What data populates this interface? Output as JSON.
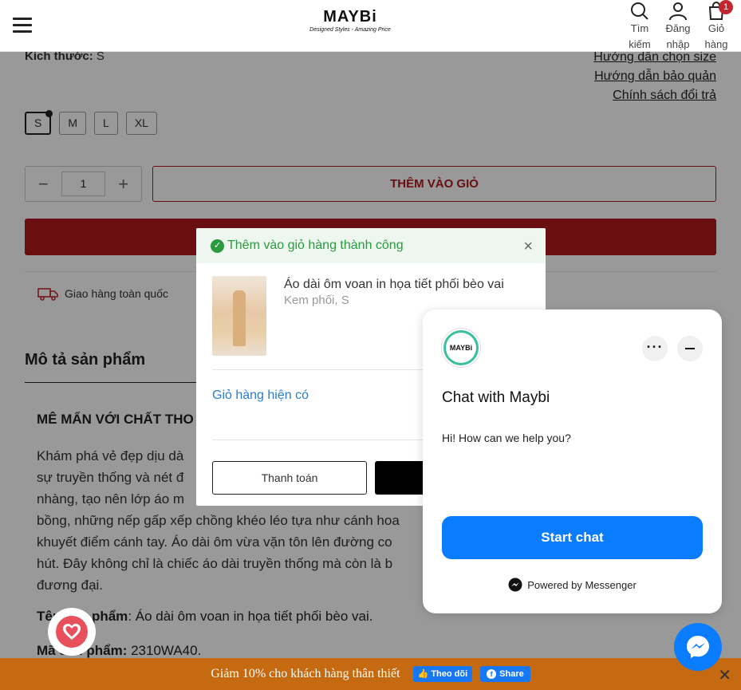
{
  "header": {
    "logo_text": "MAYBi",
    "logo_tagline": "Designed Styles - Amazing Price",
    "search_label_1": "Tìm",
    "search_label_2": "kiếm",
    "login_label_1": "Đăng",
    "login_label_2": "nhập",
    "cart_label_1": "Giỏ",
    "cart_label_2": "hàng",
    "cart_count": "1"
  },
  "product": {
    "size_label": "Kích thước:",
    "size_value": "S",
    "guide_links": [
      "Hướng dẫn chọn size",
      "Hướng dẫn bảo quản",
      "Chính sách đổi trả"
    ],
    "size_options": [
      "S",
      "M",
      "L",
      "XL"
    ],
    "selected_size": "S",
    "quantity": "1",
    "qty_minus": "−",
    "qty_plus": "+",
    "add_to_cart_label": "THÊM VÀO GIỎ",
    "delivery_text": "Giao hàng toàn quốc"
  },
  "description": {
    "section_title": "Mô tả sản phẩm",
    "heading": "MÊ MẨN VỚI CHẤT THO",
    "body_lines": [
      "Khám phá vẻ đẹp dịu dà",
      "sự truyền thống và nét đ",
      "nhàng, tạo nên lớp áo m",
      "bồng, những nếp gấp xếp chồng khéo léo tựa như cánh hoa",
      "khuyết điểm cánh tay. Áo dài ôm vừa vặn tôn lên đường co",
      "hút. Đây không chỉ là chiếc áo dài truyền thống mà còn là b",
      "đương đại."
    ],
    "spec1_label": "Tên sản phẩm",
    "spec1_value": ": Áo dài ôm voan in họa tiết phối bèo vai.",
    "spec2_label": "Mã sản phẩm:",
    "spec2_value": " 2310WA40."
  },
  "cart_popup": {
    "title": "Thêm vào giỏ hàng thành công",
    "close": "×",
    "item_name": "Áo dài ôm voan in họa tiết phối bèo vai",
    "item_variant": "Kem phối, S",
    "current_cart_link": "Giỏ hàng hiện có",
    "pay_button": "Thanh toán",
    "view_button": "X"
  },
  "chat_widget": {
    "avatar_text": "MAYBi",
    "title": "Chat with Maybi",
    "message": "Hi! How can we help you?",
    "start_button": "Start chat",
    "powered_by": "Powered by Messenger"
  },
  "promo_bar": {
    "text": "Giảm 10% cho khách hàng thân thiết",
    "follow_label": "Theo dõi",
    "share_label": "Share",
    "close": "✕"
  },
  "colors": {
    "brand_red": "#b0191e",
    "success_green": "#2a9a3f",
    "messenger_blue": "#0a7cff",
    "promo_orange": "#c56a10",
    "facebook_blue": "#1877f2"
  }
}
